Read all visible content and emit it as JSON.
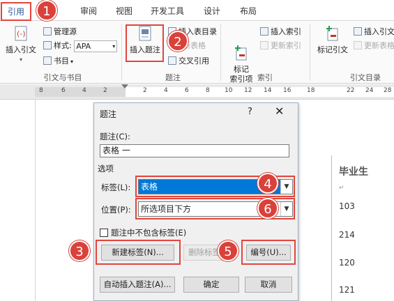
{
  "tabs": [
    "引用",
    "审阅",
    "视图",
    "开发工具",
    "设计",
    "布局"
  ],
  "ribbon": {
    "citations": {
      "insert_citation": "插入引文",
      "manage_sources": "管理源",
      "style_label": "样式:",
      "style_value": "APA",
      "bibliography": "书目",
      "group_label": "引文与书目"
    },
    "captions": {
      "insert_caption": "插入题注",
      "insert_table_of_figures": "插入表目录",
      "update_table": "新表格",
      "cross_reference": "交叉引用",
      "group_label": "题注"
    },
    "index": {
      "mark_entry": "标记\n索引项",
      "insert_index": "插入索引",
      "update_index": "更新索引",
      "group_label": "索引"
    },
    "toa": {
      "mark_citation": "标记引文",
      "insert_toa": "插入引文",
      "update_toa": "更新表格",
      "group_label": "引文目录"
    }
  },
  "ruler_ticks": [
    "8",
    "6",
    "4",
    "2",
    "2",
    "4",
    "6",
    "8",
    "10",
    "12",
    "14",
    "16",
    "18",
    "22",
    "24",
    "28"
  ],
  "document": {
    "header": "毕业生",
    "rows": [
      "103",
      "214",
      "120",
      "121"
    ]
  },
  "dialog": {
    "title": "题注",
    "help": "?",
    "close": "✕",
    "caption_label": "题注(C):",
    "caption_value": "表格 一",
    "options_label": "选项",
    "label_label": "标签(L):",
    "label_value": "表格",
    "position_label": "位置(P):",
    "position_value": "所选项目下方",
    "exclude_label": "题注中不包含标签(E)",
    "new_label_button": "新建标签(N)...",
    "delete_label_button": "删除标签",
    "numbering_button": "编号(U)...",
    "autocaption_button": "自动插入题注(A)...",
    "ok_button": "确定",
    "cancel_button": "取消"
  },
  "callouts": [
    "1",
    "2",
    "3",
    "4",
    "5",
    "6"
  ],
  "colors": {
    "callout": "#d9413a",
    "highlight": "#e0453d",
    "selection": "#0078d7"
  }
}
